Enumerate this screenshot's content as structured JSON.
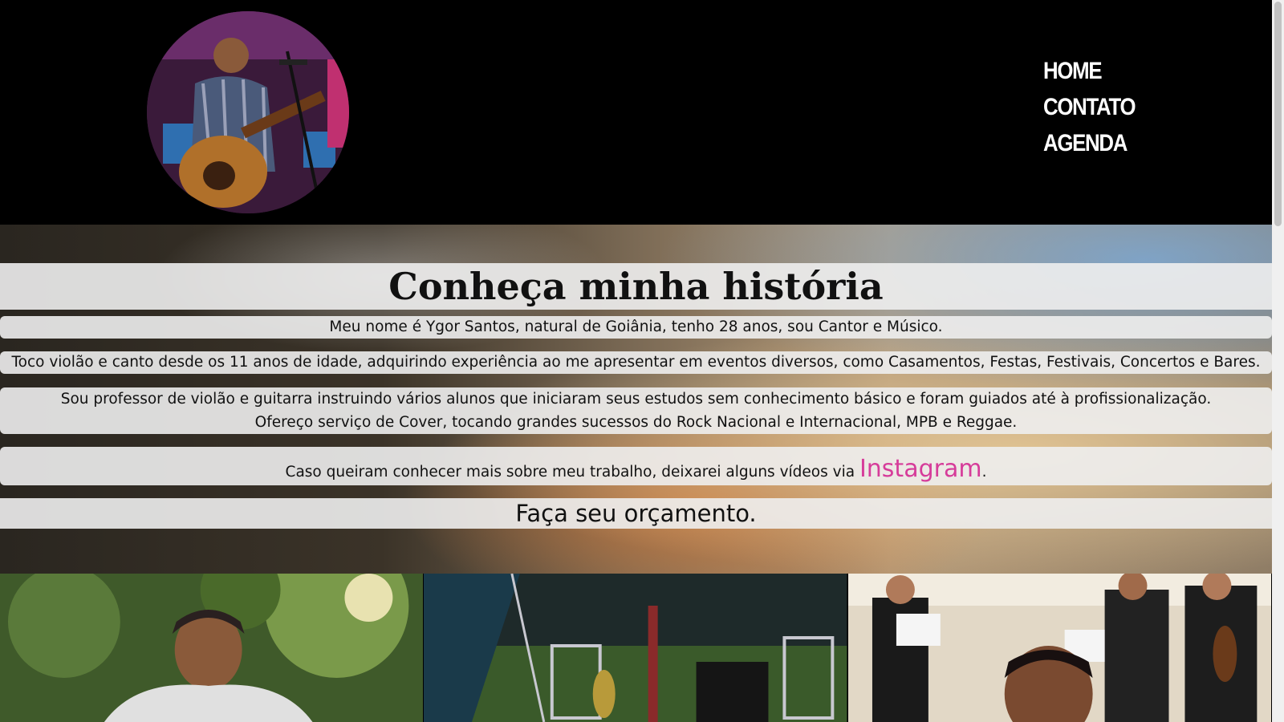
{
  "header": {
    "nav": [
      {
        "label": "HOME"
      },
      {
        "label": "CONTATO"
      },
      {
        "label": "AGENDA"
      }
    ]
  },
  "about": {
    "title": "Conheça minha história",
    "p1": "Meu nome é Ygor Santos, natural de Goiânia, tenho 28 anos, sou Cantor e Músico.",
    "p2": "Toco violão e canto desde os 11 anos de idade, adquirindo experiência ao me apresentar em eventos diversos, como Casamentos, Festas, Festivais, Concertos e Bares.",
    "p3a": "Sou professor de violão e guitarra instruindo vários alunos que iniciaram seus estudos sem conhecimento básico e foram guiados até à profissionalização.",
    "p3b": "Ofereço serviço de Cover, tocando grandes sucessos do Rock Nacional e Internacional, MPB e Reggae.",
    "p4_before": "Caso queiram conhecer mais sobre meu trabalho, deixarei alguns vídeos via ",
    "p4_link": "Instagram",
    "p4_after": ".",
    "cta": "Faça seu orçamento."
  },
  "colors": {
    "header_bg": "#000000",
    "band_bg": "#eeeeee",
    "instagram_link": "#d63c9a"
  }
}
